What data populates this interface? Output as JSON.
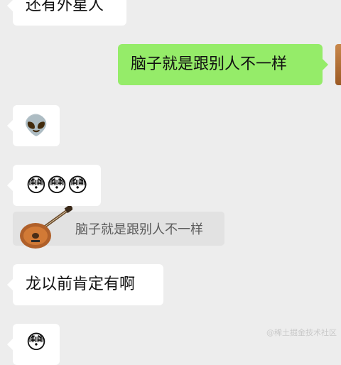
{
  "messages": [
    {
      "text": "还有外星人"
    },
    {
      "text": "脑子就是跟别人不一样"
    },
    {
      "text": "👽"
    },
    {
      "text": "😳😳😳"
    },
    {
      "quote": "脑子就是跟别人不一样"
    },
    {
      "text": "龙以前肯定有啊"
    },
    {
      "text": "😳"
    }
  ],
  "watermark": "@稀土掘金技术社区",
  "icons": {
    "quote_thumbnail": "guitar-icon",
    "right_avatar": "avatar"
  }
}
